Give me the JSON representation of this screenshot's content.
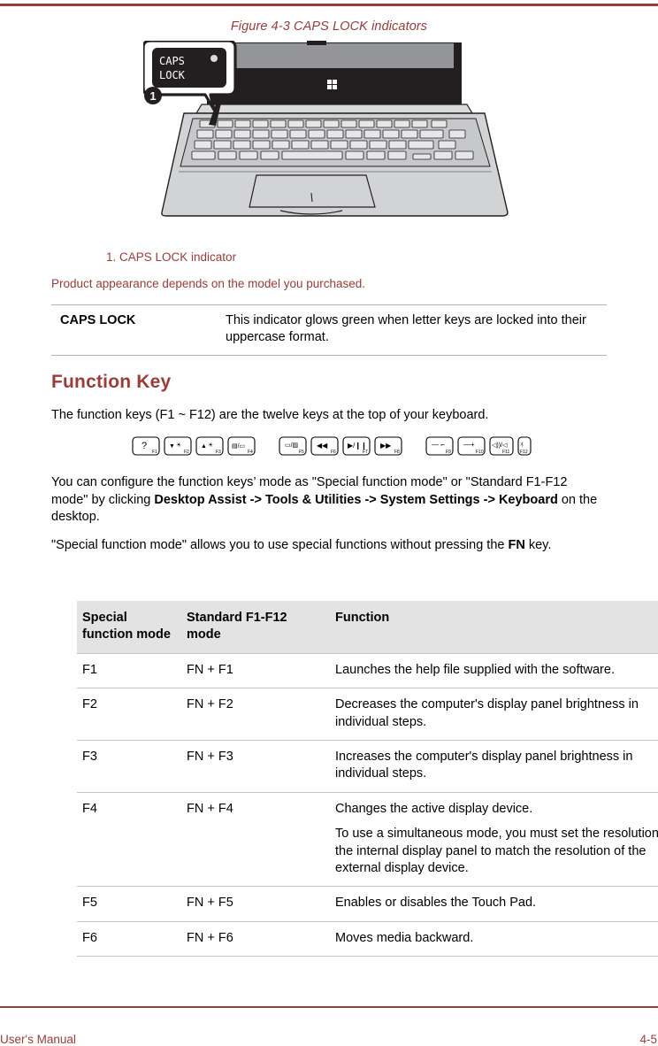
{
  "page": {
    "figure_caption": "Figure 4-3 CAPS LOCK indicators",
    "figure_callout_number": "1",
    "indicator_label_line1": "CAPS",
    "indicator_label_line2": "LOCK",
    "figure_legend": "1. CAPS LOCK indicator",
    "figure_note": "Product appearance depends on the model you purchased."
  },
  "def_table": {
    "term": "CAPS LOCK",
    "description": "This indicator glows green when letter keys are locked into their uppercase format."
  },
  "section": {
    "title": "Function Key",
    "intro": "The function keys (F1 ~ F12) are the twelve keys at the top of your keyboard.",
    "configure_part1": "You can configure the function keys’ mode as \"Special function mode\" or \"Standard F1-F12 mode\" by clicking ",
    "configure_bold": "Desktop Assist -> Tools & Utilities -> System Settings -> Keyboard",
    "configure_part2": " on the desktop.",
    "special_part1": "\"Special function mode\" allows you to use special functions without pressing the ",
    "special_bold": "FN",
    "special_part2": " key."
  },
  "fkey_strip": [
    {
      "key": "F1",
      "icon": "help-question-icon",
      "glyph": "?"
    },
    {
      "key": "F2",
      "icon": "brightness-down-icon",
      "glyph": "▼☀"
    },
    {
      "key": "F3",
      "icon": "brightness-up-icon",
      "glyph": "▲☀"
    },
    {
      "key": "F4",
      "icon": "display-switch-icon",
      "glyph": "▤/▢"
    },
    {
      "key": "F5",
      "icon": "touchpad-toggle-icon",
      "glyph": "▭/▨"
    },
    {
      "key": "F6",
      "icon": "media-previous-icon",
      "glyph": "◀◀"
    },
    {
      "key": "F7",
      "icon": "media-play-pause-icon",
      "glyph": "▶/❙❙"
    },
    {
      "key": "F8",
      "icon": "media-next-icon",
      "glyph": "▶▶"
    },
    {
      "key": "F9",
      "icon": "keyboard-backlight-down-icon",
      "glyph": "—"
    },
    {
      "key": "F10",
      "icon": "keyboard-backlight-up-icon",
      "glyph": "—+"
    },
    {
      "key": "F11",
      "icon": "volume-down-up-icon",
      "glyph": "◁))/◁"
    },
    {
      "key": "F12",
      "icon": "wireless-toggle-icon",
      "glyph": "((ᗐ))"
    }
  ],
  "fn_table": {
    "headers": {
      "col1": "Special function mode",
      "col2": "Standard F1-F12 mode",
      "col3": "Function"
    },
    "rows": [
      {
        "special": "F1",
        "standard": "FN + F1",
        "function": [
          "Launches the help file supplied with the software."
        ]
      },
      {
        "special": "F2",
        "standard": "FN + F2",
        "function": [
          "Decreases the computer's display panel brightness in individual steps."
        ]
      },
      {
        "special": "F3",
        "standard": "FN + F3",
        "function": [
          "Increases the computer's display panel brightness in individual steps."
        ]
      },
      {
        "special": "F4",
        "standard": "FN + F4",
        "function": [
          "Changes the active display device.",
          "To use a simultaneous mode, you must set the resolution of the internal display panel to match the resolution of the external display device."
        ]
      },
      {
        "special": "F5",
        "standard": "FN + F5",
        "function": [
          "Enables or disables the Touch Pad."
        ]
      },
      {
        "special": "F6",
        "standard": "FN + F6",
        "function": [
          "Moves media backward."
        ]
      }
    ]
  },
  "footer": {
    "left": "User's Manual",
    "right": "4-5"
  },
  "colors": {
    "accent": "#9d3b38",
    "table_header_bg": "#e3e3e3",
    "rule": "#c4c4c4"
  }
}
